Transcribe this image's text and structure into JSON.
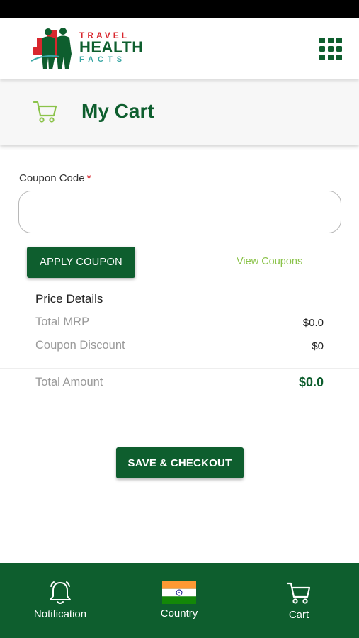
{
  "header": {
    "logo_line1": "TRAVEL",
    "logo_line2": "HEALTH",
    "logo_line3": "FACTS",
    "menu_icon": "grid-icon"
  },
  "page": {
    "title": "My Cart",
    "icon": "cart-icon"
  },
  "coupon": {
    "label": "Coupon Code",
    "required_mark": "*",
    "value": "",
    "placeholder": "",
    "apply_label": "APPLY COUPON",
    "view_label": "View Coupons"
  },
  "price": {
    "title": "Price Details",
    "mrp_label": "Total MRP",
    "mrp_value": "$0.0",
    "discount_label": "Coupon Discount",
    "discount_value": "$0",
    "total_label": "Total Amount",
    "total_value": "$0.0"
  },
  "checkout": {
    "label": "SAVE & CHECKOUT"
  },
  "nav": {
    "items": [
      {
        "label": "Notification",
        "icon": "bell-icon"
      },
      {
        "label": "Country",
        "icon": "india-flag-icon"
      },
      {
        "label": "Cart",
        "icon": "cart-icon"
      }
    ]
  },
  "colors": {
    "brand_green": "#0e5e2e",
    "accent_light_green": "#8bc34a",
    "logo_red": "#d8272e",
    "logo_teal": "#3aa7a4"
  }
}
